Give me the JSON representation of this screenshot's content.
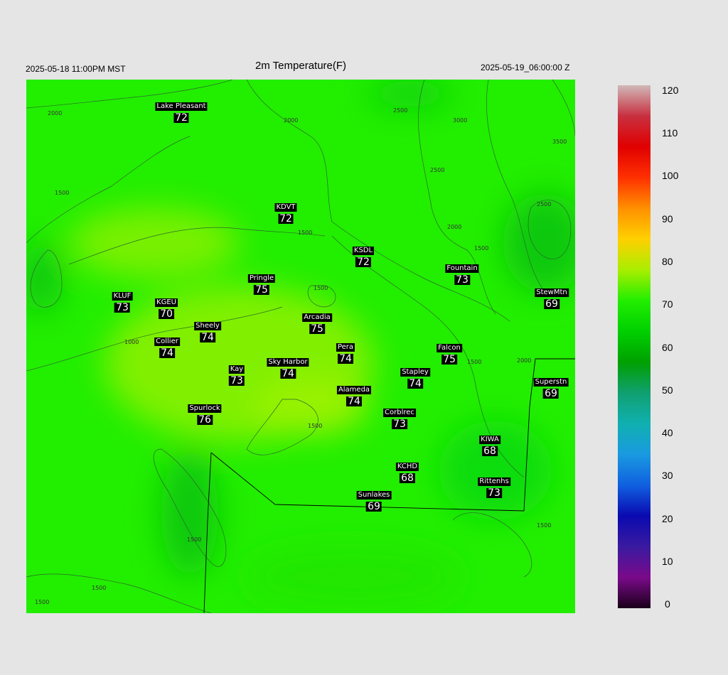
{
  "header": {
    "left": "2025-05-18 11:00PM MST",
    "title": "2m Temperature(F)",
    "right": "2025-05-19_06:00:00 Z"
  },
  "stations": [
    {
      "name": "Lake Pleasant",
      "value": "72"
    },
    {
      "name": "KDVT",
      "value": "72"
    },
    {
      "name": "KSDL",
      "value": "72"
    },
    {
      "name": "Fountain",
      "value": "73"
    },
    {
      "name": "Pringle",
      "value": "75"
    },
    {
      "name": "StewMtn",
      "value": "69"
    },
    {
      "name": "KLUF",
      "value": "73"
    },
    {
      "name": "KGEU",
      "value": "70"
    },
    {
      "name": "Arcadia",
      "value": "75"
    },
    {
      "name": "Sheely",
      "value": "74"
    },
    {
      "name": "Collier",
      "value": "74"
    },
    {
      "name": "Pera",
      "value": "74"
    },
    {
      "name": "Falcon",
      "value": "75"
    },
    {
      "name": "Sky Harbor",
      "value": "74"
    },
    {
      "name": "Kay",
      "value": "73"
    },
    {
      "name": "Stapley",
      "value": "74"
    },
    {
      "name": "Superstn",
      "value": "69"
    },
    {
      "name": "Alameda",
      "value": "74"
    },
    {
      "name": "Spurlock",
      "value": "76"
    },
    {
      "name": "Corblrec",
      "value": "73"
    },
    {
      "name": "KIWA",
      "value": "68"
    },
    {
      "name": "KCHD",
      "value": "68"
    },
    {
      "name": "Rittenhs",
      "value": "73"
    },
    {
      "name": "Sunlakes",
      "value": "69"
    }
  ],
  "contour_labels": [
    "2000",
    "2000",
    "2500",
    "3000",
    "3500",
    "2500",
    "2500",
    "2000",
    "1500",
    "1500",
    "1500",
    "1500",
    "1000",
    "1500",
    "1500",
    "1500",
    "2000",
    "1500",
    "1500",
    "1500"
  ],
  "colorbar": {
    "ticks": [
      "120",
      "110",
      "100",
      "90",
      "80",
      "70",
      "60",
      "50",
      "40",
      "30",
      "20",
      "10",
      "0"
    ],
    "colors": [
      "#1a001a",
      "#7a0a8a",
      "#3a1aa0",
      "#0a0ab0",
      "#1060e0",
      "#1a9ae0",
      "#10b0b0",
      "#10a070",
      "#00a000",
      "#00d000",
      "#22ee00",
      "#aaee00",
      "#ffd000",
      "#ff9000",
      "#ff3000",
      "#e00000",
      "#c83040",
      "#d0b8b8"
    ]
  },
  "field_colors": {
    "base": "#22ee00",
    "warm": "#66f000",
    "warmer": "#90f000",
    "cool": "#10d810"
  }
}
